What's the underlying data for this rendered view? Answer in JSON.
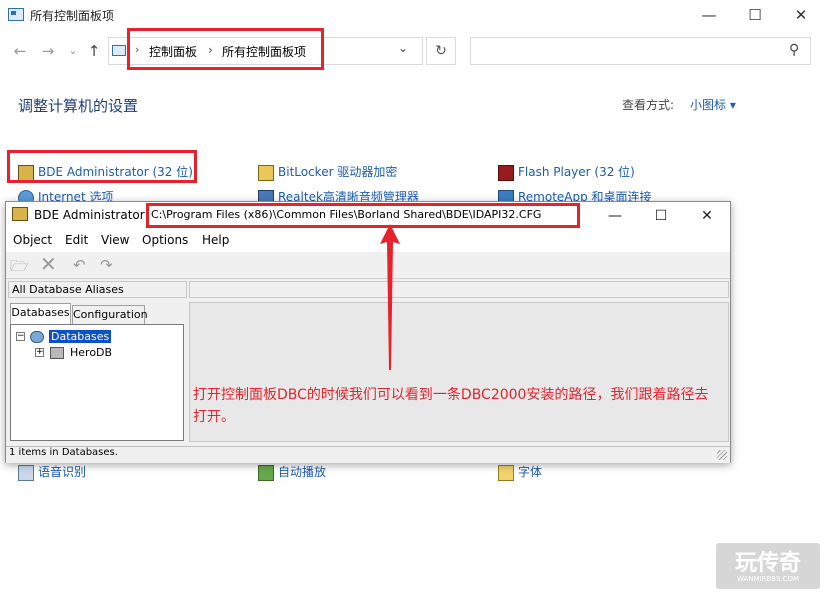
{
  "window": {
    "title": "所有控制面板项",
    "minimize": "—",
    "maximize": "☐",
    "close": "✕"
  },
  "nav": {
    "back": "←",
    "forward": "→",
    "up_history": "⌄",
    "up": "↑",
    "address_separator": "›",
    "refresh": "↻"
  },
  "breadcrumb": {
    "items": [
      "控制面板",
      "所有控制面板项"
    ],
    "separator": "›",
    "dropdown": "⌄"
  },
  "search": {
    "placeholder": "",
    "icon": "search-icon",
    "icon_glyph": "⚲"
  },
  "heading": "调整计算机的设置",
  "view_by": {
    "label": "查看方式:",
    "value": "小图标 ▾"
  },
  "control_items": [
    {
      "label": "BDE Administrator (32 位)",
      "icon": "bde-icon"
    },
    {
      "label": "BitLocker 驱动器加密",
      "icon": "bitlocker-icon"
    },
    {
      "label": "Flash Player (32 位)",
      "icon": "flash-icon"
    },
    {
      "label": "Internet 选项",
      "icon": "internet-icon"
    },
    {
      "label": "Realtek高清晰音频管理器",
      "icon": "realtek-icon"
    },
    {
      "label": "RemoteApp 和桌面连接",
      "icon": "remoteapp-icon"
    },
    {
      "label": "语音识别",
      "icon": "microphone-icon"
    },
    {
      "label": "自动播放",
      "icon": "autoplay-icon"
    },
    {
      "label": "字体",
      "icon": "font-icon"
    }
  ],
  "bde": {
    "title": "BDE Administrator",
    "path": "C:\\Program Files (x86)\\Common Files\\Borland Shared\\BDE\\IDAPI32.CFG",
    "menu": [
      "Object",
      "Edit",
      "View",
      "Options",
      "Help"
    ],
    "toolbar": {
      "open": "🗁",
      "delete": "✕",
      "undo": "↶",
      "redo": "↷"
    },
    "alias_label": "All Database Aliases",
    "tabs": [
      "Databases",
      "Configuration"
    ],
    "tree": {
      "root": "Databases",
      "child": "HeroDB",
      "root_expander": "−",
      "child_expander": "+"
    },
    "status": "1 items in Databases.",
    "caption": {
      "minimize": "—",
      "maximize": "☐",
      "close": "✕"
    }
  },
  "annotation": "打开控制面板DBC的时候我们可以看到一条DBC2000安装的路径，我们跟着路径去打开。",
  "watermark": {
    "big": "玩传奇",
    "small": "WANMIRBBS.COM"
  },
  "colors": {
    "annotation_red": "#e8222a",
    "link_blue": "#1a5bb5",
    "heading_navy": "#1e3f7a"
  }
}
